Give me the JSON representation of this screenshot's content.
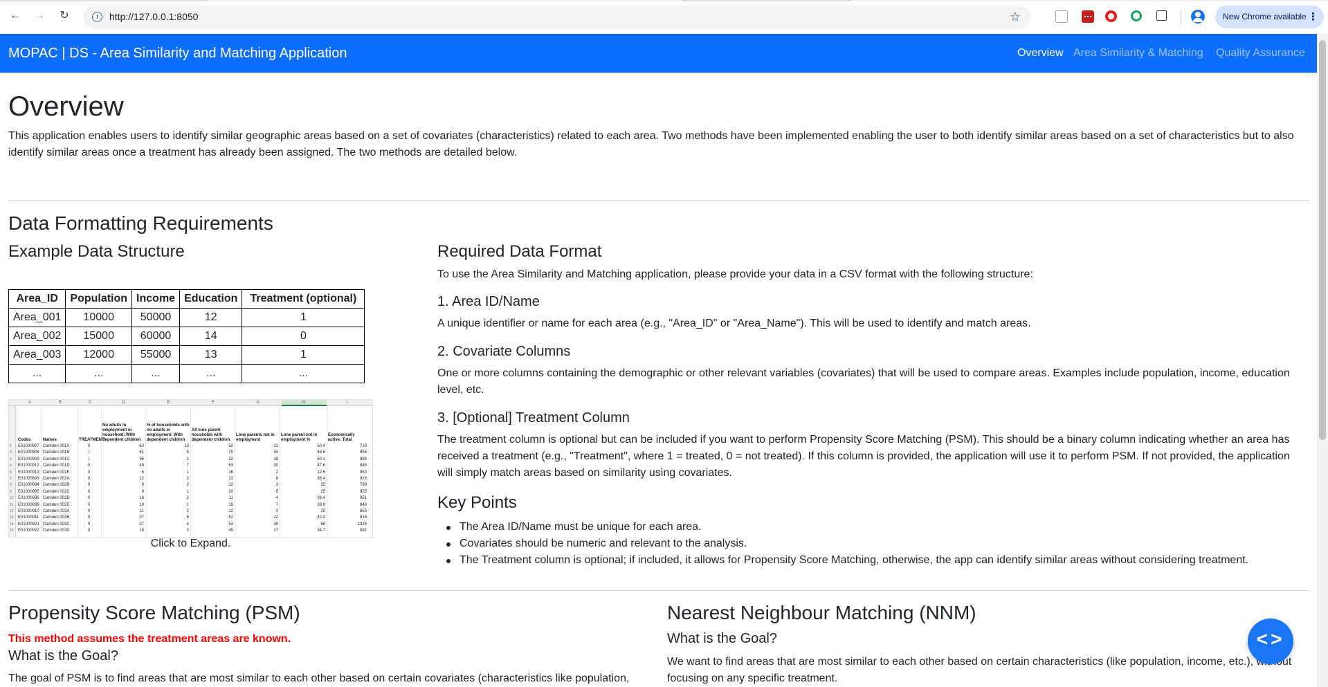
{
  "browser": {
    "url": "http://127.0.0.1:8050",
    "update_label": "New Chrome available"
  },
  "navbar": {
    "brand": "MOPAC | DS - Area Similarity and Matching Application",
    "links": [
      {
        "label": "Overview",
        "active": true
      },
      {
        "label": "Area Similarity & Matching",
        "active": false
      },
      {
        "label": "Quality Assurance",
        "active": false
      }
    ]
  },
  "overview": {
    "title": "Overview",
    "intro": [
      "This application enables users to identify similar geographic areas based on a set of covariates (characteristics) related to each area. Two methods have been implemented enabling the user to both identify similar areas based on a set of characteristics but to also",
      "identify similar areas once a treatment has already been assigned. The two methods are detailed below."
    ]
  },
  "data_formatting": {
    "title": "Data Formatting Requirements",
    "example_title": "Example Data Structure",
    "table": {
      "headers": [
        "Area_ID",
        "Population",
        "Income",
        "Education",
        "Treatment (optional)"
      ],
      "rows": [
        [
          "Area_001",
          "10000",
          "50000",
          "12",
          "1"
        ],
        [
          "Area_002",
          "15000",
          "60000",
          "14",
          "0"
        ],
        [
          "Area_003",
          "12000",
          "55000",
          "13",
          "1"
        ],
        [
          "...",
          "...",
          "...",
          "...",
          "..."
        ]
      ]
    },
    "sheet_preview": {
      "column_letters": [
        "A",
        "B",
        "C",
        "D",
        "E",
        "F",
        "G",
        "H",
        "I"
      ],
      "headers": [
        "Codes",
        "Names",
        "TREATMENT",
        "No adults in employment in household: With dependent children",
        "% of households with no adults in employment: With dependent children",
        "All lone parent housholds with dependent children",
        "Lone parents not in employment",
        "Lone parent not in employment %",
        "Economically active: Total"
      ],
      "rows": [
        [
          "E01000907",
          "Camden 001A",
          "0",
          "63",
          "10",
          "50",
          "31",
          "50.4",
          "719"
        ],
        [
          "E01000908",
          "Camden 001B",
          "1",
          "61",
          "5",
          "70",
          "34",
          "48.6",
          "855"
        ],
        [
          "E01000909",
          "Camden 001C",
          "1",
          "95",
          "2",
          "22",
          "18",
          "50.1",
          "886"
        ],
        [
          "E01000912",
          "Camden 001D",
          "0",
          "49",
          "7",
          "63",
          "30",
          "47.6",
          "848"
        ],
        [
          "E01000913",
          "Camden 001E",
          "0",
          "6",
          "1",
          "16",
          "2",
          "12.5",
          "963"
        ],
        [
          "E01000893",
          "Camden 002A",
          "0",
          "12",
          "2",
          "22",
          "8",
          "36.4",
          "926"
        ],
        [
          "E01000894",
          "Camden 002B",
          "0",
          "9",
          "2",
          "12",
          "3",
          "25",
          "799"
        ],
        [
          "E01000895",
          "Camden 002C",
          "0",
          "9",
          "1",
          "20",
          "5",
          "25",
          "925"
        ],
        [
          "E01000896",
          "Camden 002D",
          "0",
          "16",
          "2",
          "11",
          "4",
          "36.4",
          "951"
        ],
        [
          "E01000898",
          "Camden 002E",
          "0",
          "10",
          "1",
          "18",
          "7",
          "38.9",
          "848"
        ],
        [
          "E01000910",
          "Camden 003A",
          "0",
          "11",
          "2",
          "12",
          "3",
          "25",
          "853"
        ],
        [
          "E01000911",
          "Camden 003B",
          "0",
          "37",
          "6",
          "52",
          "22",
          "42.3",
          "816"
        ],
        [
          "E01000921",
          "Camden 003C",
          "0",
          "37",
          "4",
          "53",
          "35",
          "66",
          "1326"
        ],
        [
          "E01000922",
          "Camden 003D",
          "0",
          "18",
          "3",
          "49",
          "17",
          "34.7",
          "882"
        ]
      ]
    },
    "caption": "Click to Expand.",
    "required_title": "Required Data Format",
    "required_intro": "To use the Area Similarity and Matching application, please provide your data in a CSV format with the following structure:",
    "sections": [
      {
        "title": "1. Area ID/Name",
        "lines": [
          "A unique identifier or name for each area (e.g., \"Area_ID\" or \"Area_Name\"). This will be used to identify and match areas."
        ]
      },
      {
        "title": "2. Covariate Columns",
        "lines": [
          "One or more columns containing the demographic or other relevant variables (covariates) that will be used to compare areas. Examples include population, income, education",
          "level, etc."
        ]
      },
      {
        "title": "3. [Optional] Treatment Column",
        "lines": [
          "The treatment column is optional but can be included if you want to perform Propensity Score Matching (PSM). This should be a binary column indicating whether an area has",
          "received a treatment (e.g., \"Treatment\", where 1 = treated, 0 = not treated). If this column is provided, the application will use it to perform PSM. If not provided, the application",
          "will simply match areas based on similarity using covariates."
        ]
      }
    ],
    "key_points_title": "Key Points",
    "key_points": [
      "The Area ID/Name must be unique for each area.",
      "Covariates should be numeric and relevant to the analysis.",
      "The Treatment column is optional; if included, it allows for Propensity Score Matching, otherwise, the app can identify similar areas without considering treatment."
    ]
  },
  "psm": {
    "title": "Propensity Score Matching (PSM)",
    "warning": "This method assumes the treatment areas are known.",
    "goal_title": "What is the Goal?",
    "goal_text": "The goal of PSM is to find areas that are most similar to each other based on certain covariates (characteristics like population,"
  },
  "nnm": {
    "title": "Nearest Neighbour Matching (NNM)",
    "goal_title": "What is the Goal?",
    "goal_lines": [
      "We want to find areas that are most similar to each other based on certain characteristics (like population, income, etc.), without",
      "focusing on any specific treatment."
    ]
  },
  "icons": {
    "back": "back-arrow-icon",
    "forward": "forward-arrow-icon",
    "reload": "reload-icon",
    "site_info": "info-icon",
    "bookmark": "star-icon",
    "fab": "code-icon"
  },
  "colors": {
    "navbar": "#0d6efd",
    "warning": "#ff0000",
    "fab": "#1976f2"
  }
}
